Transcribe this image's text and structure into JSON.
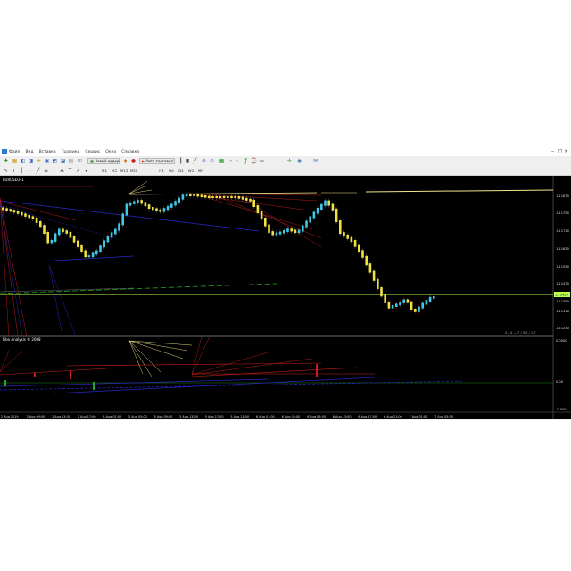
{
  "window": {
    "title_controls": [
      "–",
      "□",
      "×"
    ]
  },
  "menu": {
    "items": [
      "Файл",
      "Вид",
      "Вставка",
      "Графики",
      "Сервис",
      "Окно",
      "Справка"
    ]
  },
  "toolbar": {
    "new_order_label": "Новый ордер",
    "autotrade_label": "Авто-торговля",
    "timeframes": [
      "M1",
      "M5",
      "M15",
      "M30",
      "H1",
      "H4",
      "D1",
      "W1",
      "MN"
    ]
  },
  "chart": {
    "symbol_label": "EURUSD,H1",
    "indicator_label": "Fibo Analysis © 2008",
    "price_labels": [
      "1.11870",
      "1.11790",
      "1.11710",
      "1.11630",
      "1.11550",
      "1.11470",
      "1.11390",
      "1.11310",
      "1.11230"
    ],
    "current_price": "1.11420",
    "time_labels": [
      "2 Aug 2019",
      "2 Aug 09:00",
      "2 Aug 13:00",
      "2 Aug 17:00",
      "5 Aug 01:00",
      "5 Aug 05:00",
      "5 Aug 09:00",
      "5 Aug 13:00",
      "5 Aug 17:00",
      "5 Aug 21:00",
      "6 Aug 01:00",
      "6 Aug 05:00",
      "6 Aug 09:00",
      "6 Aug 13:00",
      "6 Aug 17:00",
      "6 Aug 21:00",
      "7 Aug 01:00",
      "7 Aug 05:00"
    ],
    "indicator_scale": [
      "0.0000",
      "0.00",
      "-0.0001"
    ],
    "corner_readout": "0 / 4  —  7  /  0.0 / 1.7",
    "colors": {
      "bull_candle": "#3cc8e6",
      "bear_candle": "#f0e040",
      "fib_red": "#c81e1e",
      "fib_yellow": "#f0e68c",
      "trend_blue": "#2828c8",
      "price_line": "#b8ff50",
      "zero_green": "#23a623"
    }
  }
}
